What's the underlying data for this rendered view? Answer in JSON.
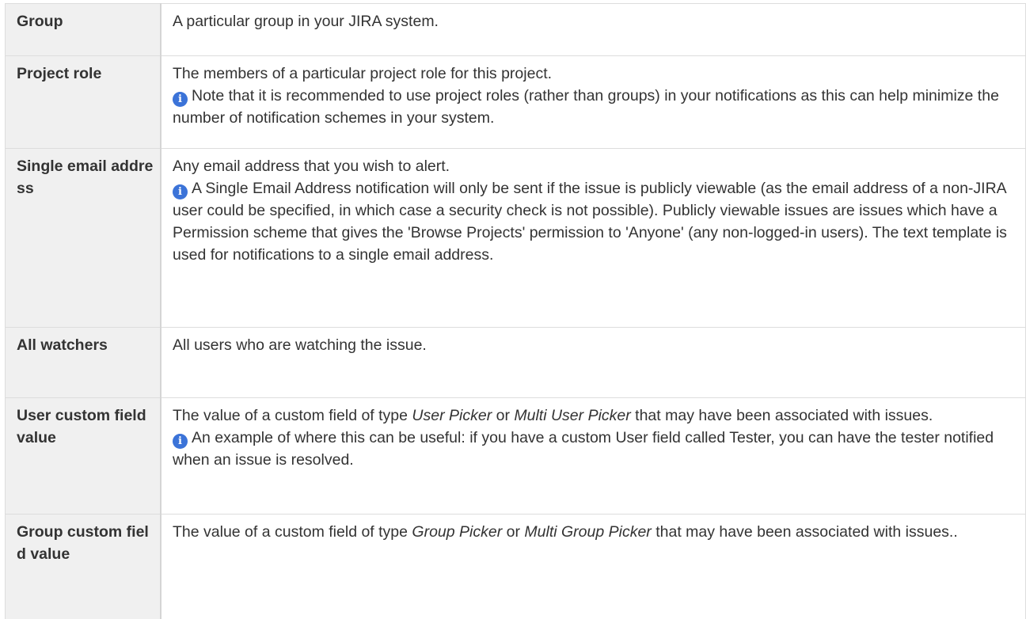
{
  "rows": [
    {
      "header": "Group",
      "description": "A particular group in your JIRA system."
    },
    {
      "header": "Project role",
      "description": "The members of a particular project role for this project.",
      "note_icon": "info-icon",
      "note": "Note that it is recommended to use project roles (rather than groups) in your notifications as this can help minimize the number of notification schemes in your system."
    },
    {
      "header": "Single email address",
      "description": "Any email address that you wish to alert.",
      "note_icon": "info-icon",
      "note": "A Single Email Address notification will only be sent if the issue is publicly viewable (as the email address of a non-JIRA user could be specified, in which case a security check is not possible). Publicly viewable issues are issues which have a Permission scheme that gives the 'Browse Projects' permission to 'Anyone' (any non-logged-in users). The text template is used for notifications to a single email address."
    },
    {
      "header": "All watchers",
      "description": "All users who are watching the issue."
    },
    {
      "header": "User custom field value",
      "desc_part1": "The value of a custom field of type ",
      "desc_em1": "User Picker",
      "desc_part2": " or ",
      "desc_em2": "Multi User Picker",
      "desc_part3": " that may have been associated with issues.",
      "note_icon": "info-icon",
      "note": "An example of where this can be useful: if you have a custom User field called Tester, you can have the tester notified when an issue is resolved."
    },
    {
      "header": "Group custom field value",
      "desc_part1": "The value of a custom field of type ",
      "desc_em1": "Group Picker",
      "desc_part2": " or ",
      "desc_em2": "Multi Group Picker",
      "desc_part3": " that may have been associated with issues.."
    }
  ],
  "colors": {
    "header_bg": "#f0f0f0",
    "border": "#dddddd",
    "text": "#333333",
    "info_icon": "#3b73d8"
  }
}
